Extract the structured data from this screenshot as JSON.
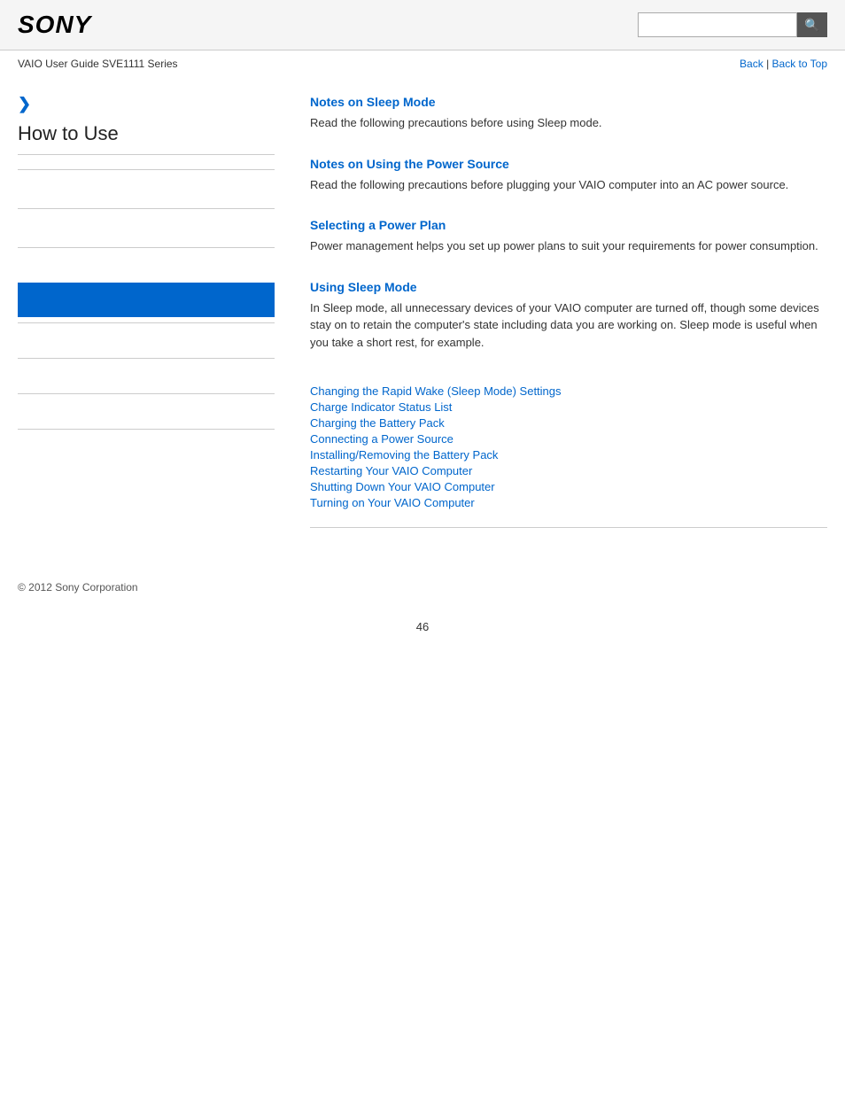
{
  "header": {
    "logo": "SONY",
    "search_placeholder": "",
    "search_icon": "🔍"
  },
  "subheader": {
    "guide_title": "VAIO User Guide SVE1111 Series",
    "back_label": "Back",
    "separator": "|",
    "back_to_top_label": "Back to Top"
  },
  "sidebar": {
    "chevron": "❯",
    "title": "How to Use",
    "items": [
      {
        "label": "",
        "type": "divider"
      },
      {
        "label": "",
        "type": "divider"
      },
      {
        "label": "",
        "type": "divider"
      },
      {
        "label": "",
        "type": "active"
      },
      {
        "label": "",
        "type": "divider"
      },
      {
        "label": "",
        "type": "divider"
      },
      {
        "label": "",
        "type": "divider"
      },
      {
        "label": "",
        "type": "divider"
      }
    ]
  },
  "content": {
    "sections": [
      {
        "id": "sleep-mode",
        "title": "Notes on Sleep Mode",
        "text": "Read the following precautions before using Sleep mode."
      },
      {
        "id": "power-source",
        "title": "Notes on Using the Power Source",
        "text": "Read the following precautions before plugging your VAIO computer into an AC power source."
      },
      {
        "id": "power-plan",
        "title": "Selecting a Power Plan",
        "text": "Power management helps you set up power plans to suit your requirements for power consumption."
      },
      {
        "id": "using-sleep",
        "title": "Using Sleep Mode",
        "text": "In Sleep mode, all unnecessary devices of your VAIO computer are turned off, though some devices stay on to retain the computer's state including data you are working on. Sleep mode is useful when you take a short rest, for example."
      }
    ],
    "links": [
      "Changing the Rapid Wake (Sleep Mode) Settings",
      "Charge Indicator Status List",
      "Charging the Battery Pack",
      "Connecting a Power Source",
      "Installing/Removing the Battery Pack",
      "Restarting Your VAIO Computer",
      "Shutting Down Your VAIO Computer",
      "Turning on Your VAIO Computer"
    ]
  },
  "footer": {
    "copyright": "© 2012 Sony Corporation"
  },
  "page_number": "46"
}
